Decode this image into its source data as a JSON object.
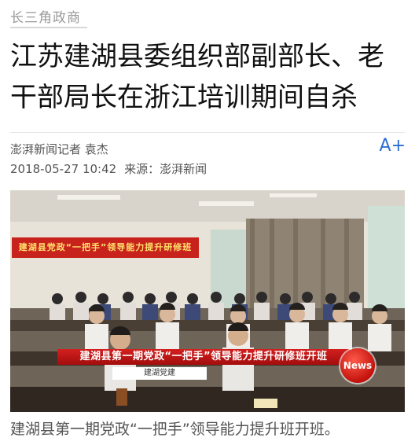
{
  "channel": "长三角政商",
  "headline": "江苏建湖县委组织部副部长、老干部局长在浙江培训期间自杀",
  "author": "澎湃新闻记者 袁杰",
  "date": "2018-05-27 10:42",
  "source": "来源：澎湃新闻",
  "font_size_button": "A+",
  "photo": {
    "banner": "建湖县党政“一把手”领导能力提升研修班",
    "ticker": "建湖县第一期党政“一把手”领导能力提升研修班开班",
    "ticker_sub": "建湖党建",
    "badge": "News"
  },
  "caption": "建湖县第一期党政“一把手”领导能力提升班开班。"
}
